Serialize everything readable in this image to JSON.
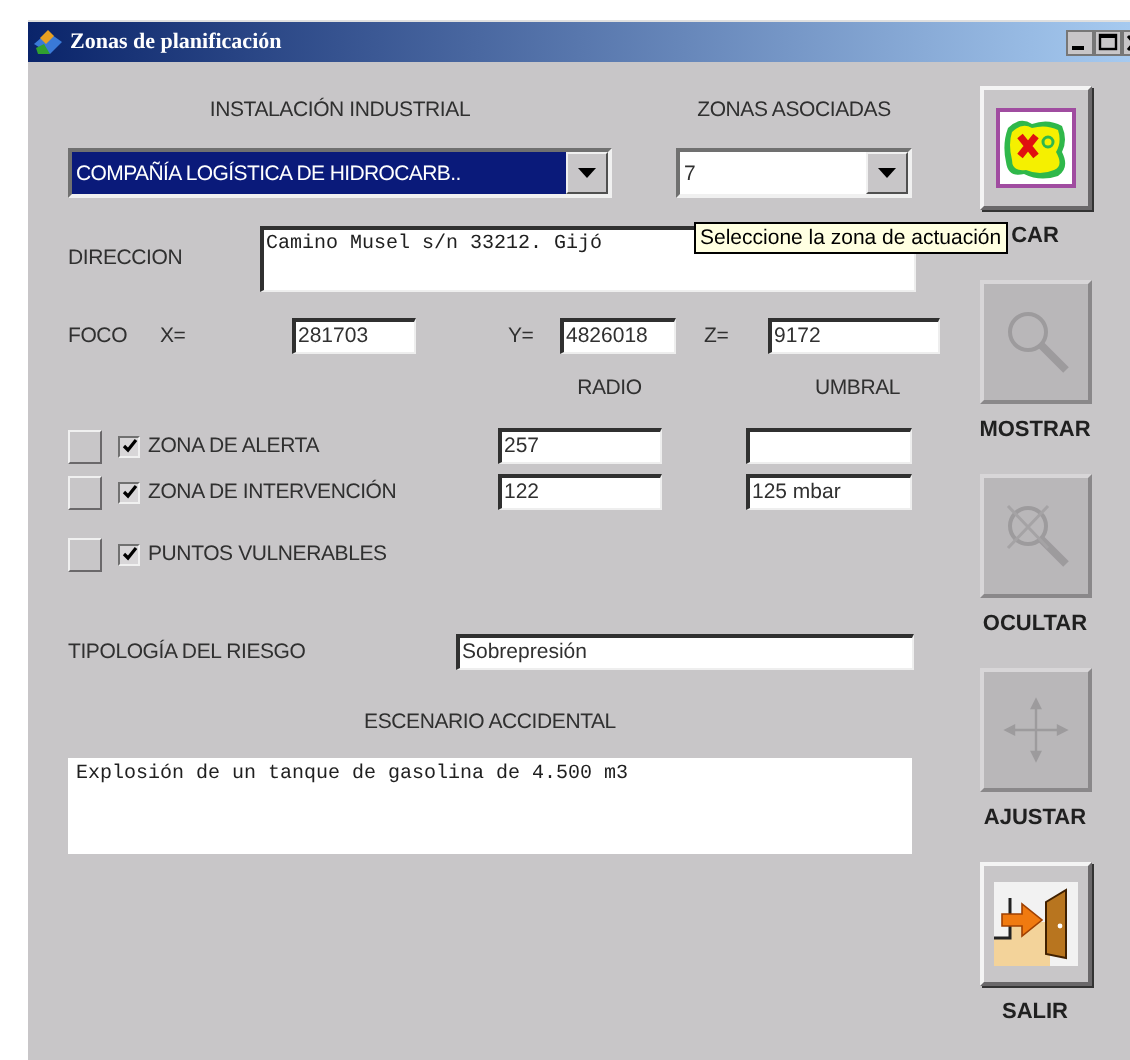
{
  "window": {
    "title": "Zonas de planificación"
  },
  "instalacion": {
    "label": "INSTALACIÓN INDUSTRIAL",
    "value": "COMPAÑÍA LOGÍSTICA DE HIDROCARB.."
  },
  "zonas": {
    "label": "ZONAS ASOCIADAS",
    "value": "7"
  },
  "tooltip": "Seleccione la zona de actuación",
  "direccion": {
    "label": "DIRECCION",
    "value": "Camino Musel s/n 33212. Gijó"
  },
  "foco": {
    "label": "FOCO",
    "coords": [
      {
        "label": "X=",
        "value": "281703"
      },
      {
        "label": "Y=",
        "value": "4826018"
      },
      {
        "label": "Z=",
        "value": "9172"
      }
    ]
  },
  "columns": [
    "RADIO",
    "UMBRAL"
  ],
  "zones": [
    {
      "kind": "zone",
      "label": "ZONA DE ALERTA",
      "checked": true,
      "radio": "257"
    },
    {
      "kind": "zone",
      "label": "ZONA DE INTERVENCIÓN",
      "checked": true,
      "radio": "122",
      "umbral": "125 mbar"
    },
    {
      "kind": "points",
      "label": "PUNTOS VULNERABLES",
      "checked": true
    }
  ],
  "tipologia": {
    "label": "TIPOLOGÍA DEL RIESGO",
    "value": "Sobrepresión"
  },
  "escenario": {
    "label": "ESCENARIO ACCIDENTAL",
    "value": "Explosión de un tanque de gasolina de 4.500 m3"
  },
  "tools": [
    {
      "kind": "map",
      "label": "CAR",
      "disabled": false
    },
    {
      "kind": "search",
      "label": "MOSTRAR",
      "disabled": true
    },
    {
      "kind": "hide",
      "label": "OCULTAR",
      "disabled": true
    },
    {
      "kind": "move",
      "label": "AJUSTAR",
      "disabled": true
    },
    {
      "kind": "exit",
      "label": "SALIR",
      "disabled": false
    }
  ]
}
